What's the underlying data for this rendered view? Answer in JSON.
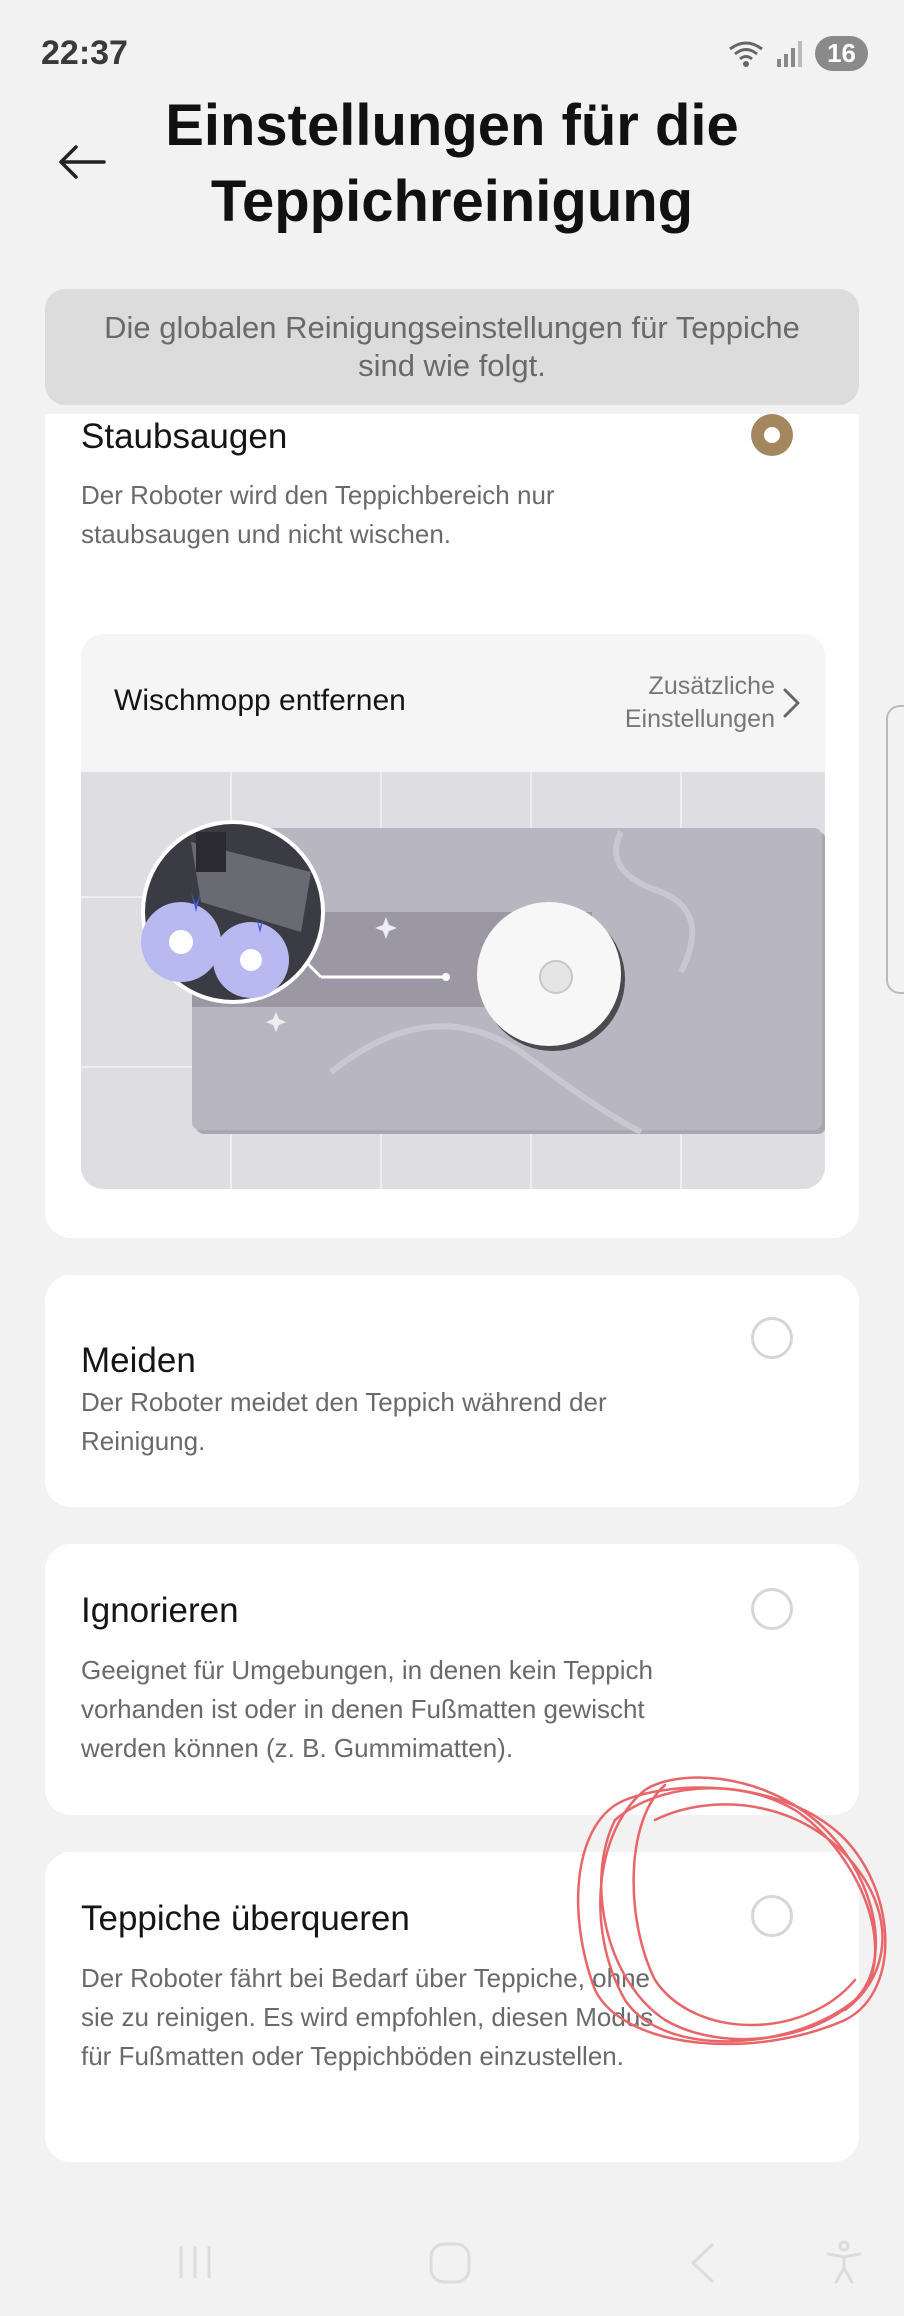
{
  "status_bar": {
    "time": "22:37",
    "battery": "16",
    "wifi_icon": "wifi-icon",
    "signal_icon": "signal-icon"
  },
  "header": {
    "title": "Einstellungen für die Teppichreinigung",
    "back_icon": "back-arrow-icon"
  },
  "info_banner": {
    "text": "Die globalen Reinigungseinstellungen für Teppiche sind wie folgt."
  },
  "options": [
    {
      "title": "Staubsaugen",
      "description": "Der Roboter wird den Teppichbereich nur staubsaugen und nicht wischen.",
      "selected": true
    },
    {
      "title": "Meiden",
      "description": "Der Roboter meidet den Teppich während der Reinigung.",
      "selected": false
    },
    {
      "title": "Ignorieren",
      "description": "Geeignet für Umgebungen, in denen kein Teppich vorhanden ist oder in denen Fußmatten gewischt werden können (z. B. Gummimatten).",
      "selected": false
    },
    {
      "title": "Teppiche überqueren",
      "description": "Der Roboter fährt bei Bedarf über Teppiche, ohne sie zu reinigen. Es wird empfohlen, diesen Modus für Fußmatten oder Teppichböden einzustellen.",
      "selected": false
    }
  ],
  "mop": {
    "label": "Wischmopp entfernen",
    "more_line1": "Zusätzliche",
    "more_line2": "Einstellungen"
  },
  "navbar": {
    "icons": [
      "recent-apps-icon",
      "home-icon",
      "back-icon",
      "accessibility-icon"
    ]
  },
  "colors": {
    "accent": "#a4875e",
    "background": "#f2f2f2",
    "card": "#ffffff",
    "scribble": "#e8666a"
  }
}
